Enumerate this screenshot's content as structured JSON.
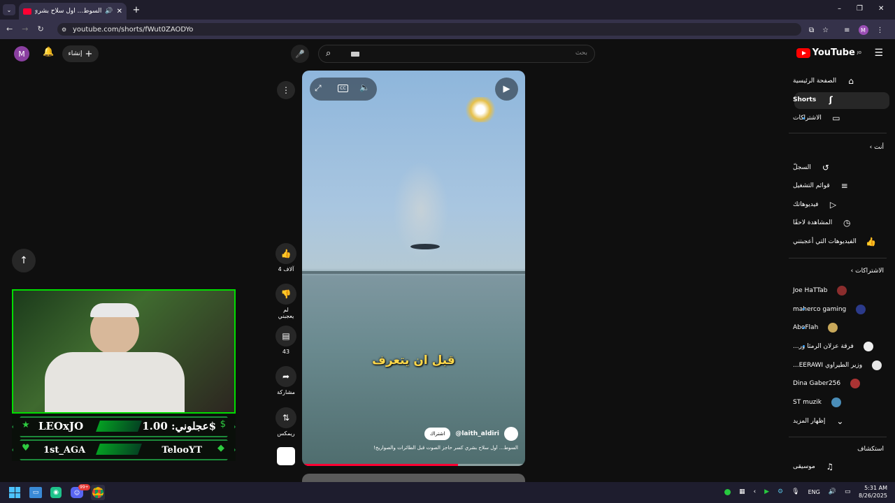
{
  "browser": {
    "tab_title": "السوط... أول سلاح بشري كسر",
    "url": "youtube.com/shorts/fWut0ZAODYo",
    "profile_initial": "M"
  },
  "header": {
    "logo_text": "YouTube",
    "logo_country": "JO",
    "search_placeholder": "بحث",
    "create_label": "إنشاء",
    "avatar_initial": "M"
  },
  "sidebar": {
    "main": [
      {
        "label": "الصفحة الرئيسية",
        "icon": "home-icon"
      },
      {
        "label": "Shorts",
        "icon": "shorts-icon"
      },
      {
        "label": "الاشتراكات",
        "icon": "subscriptions-icon"
      }
    ],
    "you_header": "أنت",
    "you": [
      {
        "label": "السجلّ",
        "icon": "history-icon"
      },
      {
        "label": "قوائم التشغيل",
        "icon": "playlist-icon"
      },
      {
        "label": "فيديوهاتك",
        "icon": "video-icon"
      },
      {
        "label": "المشاهدة لاحقًا",
        "icon": "clock-icon"
      },
      {
        "label": "الفيديوهات التي أعجبتني",
        "icon": "like-icon"
      }
    ],
    "subs_header": "الاشتراكات",
    "subscriptions": [
      {
        "label": "Joe HaTTab",
        "dot": false
      },
      {
        "label": "maherco gaming",
        "dot": true
      },
      {
        "label": "AboFlah",
        "dot": true
      },
      {
        "label": "فرقة عزلان الرمثا ور...",
        "dot": true
      },
      {
        "label": "وزير الطيراوي EERAWI...",
        "dot": false
      },
      {
        "label": "Dina Gaber256",
        "dot": false
      },
      {
        "label": "ST muzik",
        "dot": false
      }
    ],
    "show_more": "إظهار المزيد",
    "explore_header": "استكشاف",
    "explore": [
      {
        "label": "موسيقى",
        "icon": "music-icon"
      }
    ]
  },
  "short": {
    "caption_overlay": "قبل ان يتعرف",
    "channel": "@laith_aldiri",
    "subscribe_label": "اشتراك",
    "title": "السوط... أول سلاح بشري كسر حاجز الصوت قبل الطائرات والصواريخ!",
    "progress": 0.7
  },
  "actions": {
    "likes": "4 آلاف",
    "dislike_label": "لم يعجبني",
    "comments": "43",
    "share_label": "مشاركة",
    "remix_label": "ريمكس"
  },
  "overlay": {
    "left_top": "LEOxJO",
    "right_top": "عجلوني: 1.00$",
    "left_bottom": "1st_AGA",
    "right_bottom": "TelooYT"
  },
  "taskbar": {
    "lang": "ENG",
    "time": "5:31 AM",
    "date": "8/26/2025",
    "discord_badge": "99+"
  }
}
